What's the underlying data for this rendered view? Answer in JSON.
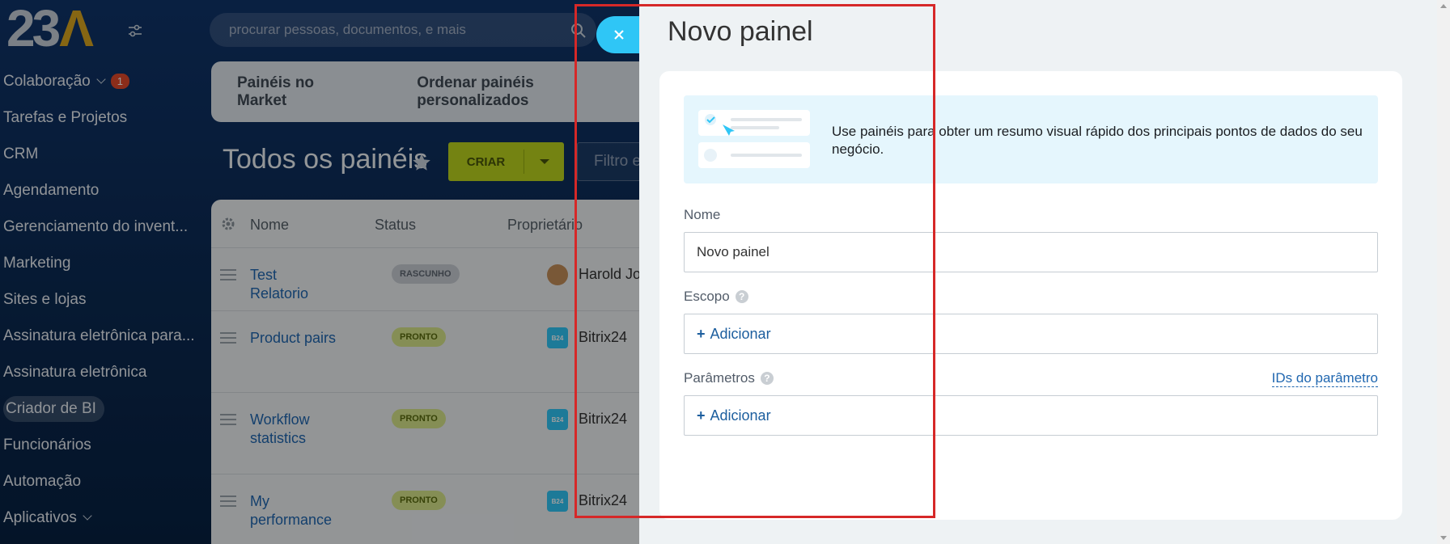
{
  "logo": {
    "num": "23",
    "mark": "Λ"
  },
  "search": {
    "placeholder": "procurar pessoas, documentos, e mais"
  },
  "sidebar": {
    "items": [
      {
        "label": "Colaboração",
        "badge": "1"
      },
      {
        "label": "Tarefas e Projetos"
      },
      {
        "label": "CRM"
      },
      {
        "label": "Agendamento"
      },
      {
        "label": "Gerenciamento do invent..."
      },
      {
        "label": "Marketing"
      },
      {
        "label": "Sites e lojas"
      },
      {
        "label": "Assinatura eletrônica para..."
      },
      {
        "label": "Assinatura eletrônica"
      },
      {
        "label": "Criador de BI"
      },
      {
        "label": "Funcionários"
      },
      {
        "label": "Automação"
      },
      {
        "label": "Aplicativos"
      }
    ]
  },
  "topnav": {
    "market": "Painéis no Market",
    "order": "Ordenar painéis personalizados"
  },
  "page": {
    "title": "Todos os painéis",
    "create_label": "CRIAR",
    "filter_placeholder": "Filtro e"
  },
  "grid": {
    "headers": {
      "name": "Nome",
      "status": "Status",
      "owner": "Proprietário"
    },
    "rows": [
      {
        "name": "Test Relatorio",
        "status": "RASCUNHO",
        "owner": "Harold Jo",
        "avatar": "photo"
      },
      {
        "name": "Product pairs",
        "status": "PRONTO",
        "owner": "Bitrix24",
        "avatar": "B24"
      },
      {
        "name": "Workflow statistics",
        "status": "PRONTO",
        "owner": "Bitrix24",
        "avatar": "B24"
      },
      {
        "name": "My performance",
        "status": "PRONTO",
        "owner": "Bitrix24",
        "avatar": "B24"
      }
    ]
  },
  "slider": {
    "title": "Novo painel",
    "info": "Use painéis para obter um resumo visual rápido dos principais pontos de dados do seu negócio.",
    "name_label": "Nome",
    "name_value": "Novo painel",
    "scope_label": "Escopo",
    "scope_add": "Adicionar",
    "params_label": "Parâmetros",
    "params_ids": "IDs do parâmetro",
    "params_add": "Adicionar",
    "plus": "+",
    "help": "?"
  },
  "colors": {
    "accent": "#2fc6f6",
    "create": "#bbd31d",
    "highlight": "#d62828"
  }
}
